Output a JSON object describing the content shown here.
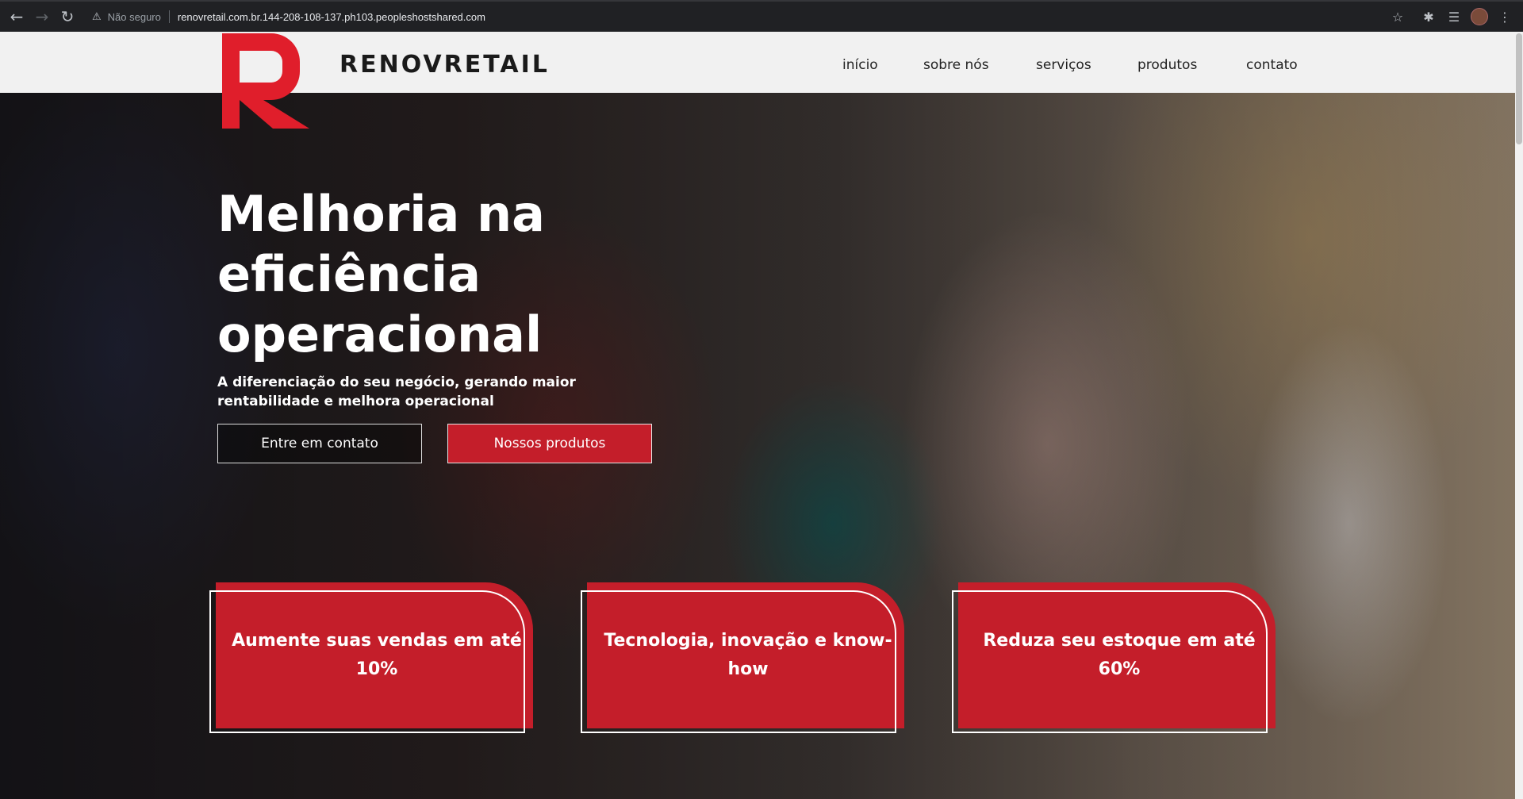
{
  "browser": {
    "back_icon": "arrow-left",
    "forward_icon": "arrow-right",
    "reload_icon": "reload",
    "security_text": "Não seguro",
    "url": "renovretail.com.br.144-208-108-137.ph103.peopleshostshared.com"
  },
  "site": {
    "brand": "RENOVRETAIL",
    "brand_color": "#e01e2b",
    "nav": [
      {
        "label": "início"
      },
      {
        "label": "sobre nós"
      },
      {
        "label": "serviços"
      },
      {
        "label": "produtos"
      },
      {
        "label": "contato"
      }
    ]
  },
  "hero": {
    "headline": "Melhoria na eficiência operacional",
    "subtitle": "A diferenciação do seu negócio, gerando maior rentabilidade e melhora operacional",
    "primary_button": "Entre em contato",
    "secondary_button": "Nossos produtos",
    "accent_color": "#c41e2a"
  },
  "cards": [
    {
      "text": "Aumente suas vendas em até 10%"
    },
    {
      "text": "Tecnologia, inovação e know-how"
    },
    {
      "text": "Reduza seu estoque em até 60%"
    }
  ]
}
